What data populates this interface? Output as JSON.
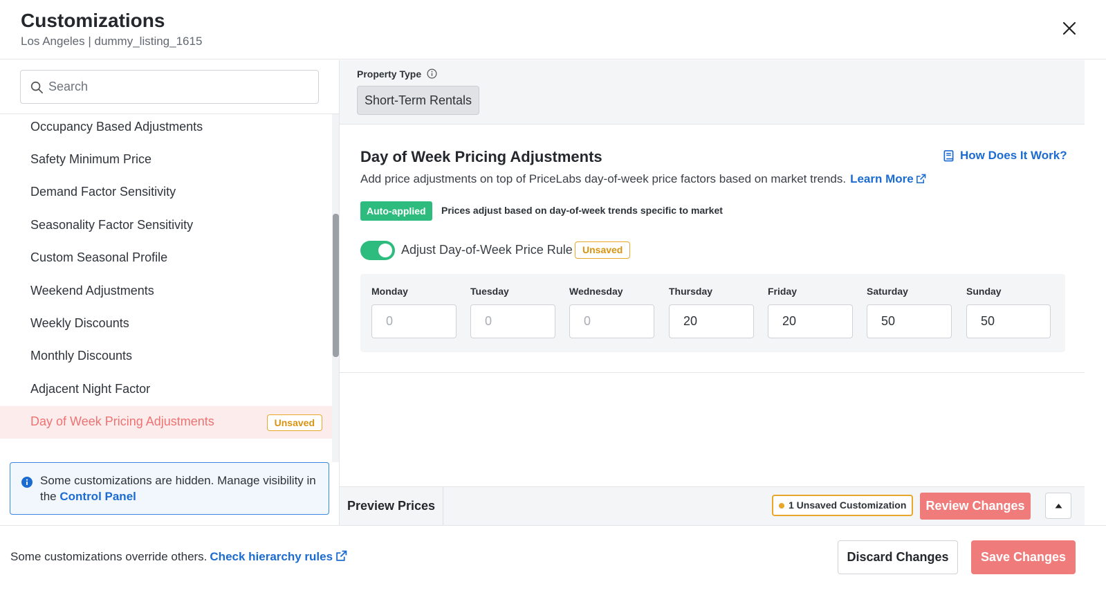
{
  "header": {
    "title": "Customizations",
    "subtitle": "Los Angeles | dummy_listing_1615"
  },
  "sidebar": {
    "search_placeholder": "Search",
    "items": [
      {
        "label": "Occupancy Based Adjustments"
      },
      {
        "label": "Safety Minimum Price"
      },
      {
        "label": "Demand Factor Sensitivity"
      },
      {
        "label": "Seasonality Factor Sensitivity"
      },
      {
        "label": "Custom Seasonal Profile"
      },
      {
        "label": "Weekend Adjustments"
      },
      {
        "label": "Weekly Discounts"
      },
      {
        "label": "Monthly Discounts"
      },
      {
        "label": "Adjacent Night Factor"
      },
      {
        "label": "Day of Week Pricing Adjustments",
        "badge": "Unsaved",
        "active": true
      }
    ],
    "info": {
      "text": "Some customizations are hidden. Manage visibility in the ",
      "link": "Control Panel"
    }
  },
  "property": {
    "label": "Property Type",
    "value": "Short-Term Rentals"
  },
  "section": {
    "title": "Day of Week Pricing Adjustments",
    "how_link": "How Does It Work?",
    "description": "Add price adjustments on top of PriceLabs day-of-week price factors based on market trends.",
    "learn_more": "Learn More",
    "auto_badge": "Auto-applied",
    "auto_desc": "Prices adjust based on day-of-week trends specific to market",
    "toggle_label": "Adjust Day-of-Week Price Rule",
    "toggle_on": true,
    "status_badge": "Unsaved",
    "days": [
      {
        "label": "Monday",
        "value": "",
        "placeholder": "0"
      },
      {
        "label": "Tuesday",
        "value": "",
        "placeholder": "0"
      },
      {
        "label": "Wednesday",
        "value": "",
        "placeholder": "0"
      },
      {
        "label": "Thursday",
        "value": "20",
        "placeholder": "0"
      },
      {
        "label": "Friday",
        "value": "20",
        "placeholder": "0"
      },
      {
        "label": "Saturday",
        "value": "50",
        "placeholder": "0"
      },
      {
        "label": "Sunday",
        "value": "50",
        "placeholder": "0"
      }
    ]
  },
  "toolbar": {
    "preview_label": "Preview Prices",
    "unsaved_count": "1 Unsaved Customization",
    "review_label": "Review Changes"
  },
  "footer": {
    "note": "Some customizations override others.",
    "hierarchy_link": "Check hierarchy rules",
    "discard_label": "Discard Changes",
    "save_label": "Save Changes"
  },
  "colors": {
    "accent_green": "#2dbc7d",
    "accent_coral": "#f07b7b",
    "link_blue": "#1b6bd1",
    "warning_amber": "#e8a72a"
  }
}
